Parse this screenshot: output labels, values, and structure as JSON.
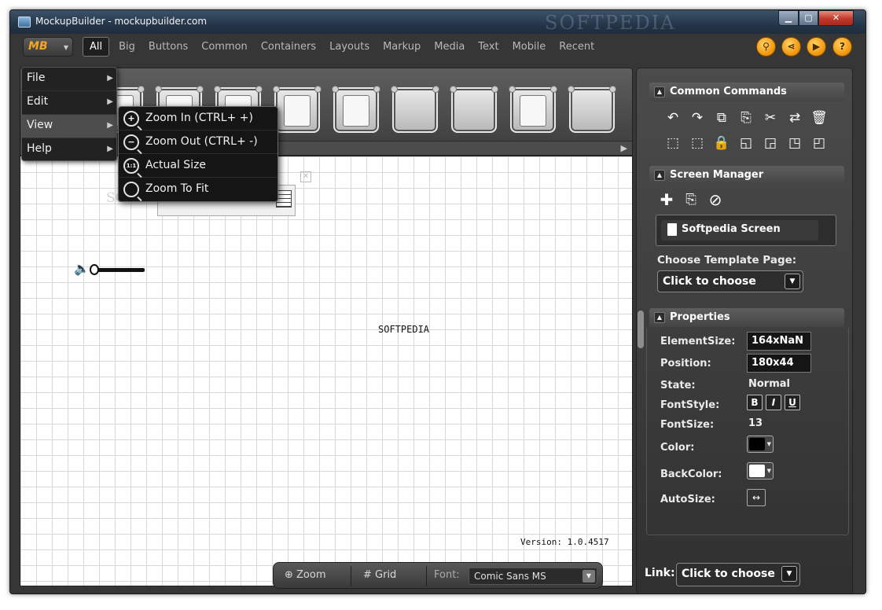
{
  "window": {
    "title": "MockupBuilder - mockupbuilder.com",
    "watermark": "SOFTPEDIA",
    "min": "▁",
    "max": "▢",
    "close": "✕"
  },
  "logo": {
    "text": "MB",
    "caret": "▼"
  },
  "tabs": [
    "All",
    "Big",
    "Buttons",
    "Common",
    "Containers",
    "Layouts",
    "Markup",
    "Media",
    "Text",
    "Mobile",
    "Recent"
  ],
  "top_buttons": [
    {
      "name": "search-icon",
      "glyph": "⚲"
    },
    {
      "name": "share-icon",
      "glyph": "⋖"
    },
    {
      "name": "play-icon",
      "glyph": "▶"
    },
    {
      "name": "help-icon",
      "glyph": "?"
    }
  ],
  "toolbar": {
    "scroll_arrow": "▶"
  },
  "menu": {
    "items": [
      {
        "label": "File",
        "sub": "▶"
      },
      {
        "label": "Edit",
        "sub": "▶"
      },
      {
        "label": "View",
        "sub": "▶"
      },
      {
        "label": "Help",
        "sub": "▶"
      }
    ],
    "highlighted": "View"
  },
  "view_submenu": [
    {
      "label": "Zoom In (CTRL+ +)",
      "icon": "zoom-in-icon",
      "glyph": "+"
    },
    {
      "label": "Zoom Out (CTRL+ -)",
      "icon": "zoom-out-icon",
      "glyph": "−"
    },
    {
      "label": "Actual Size",
      "icon": "actual-size-icon",
      "glyph": "1:1"
    },
    {
      "label": "Zoom To Fit",
      "icon": "zoom-fit-icon",
      "glyph": ""
    }
  ],
  "canvas": {
    "label": "SOFTPEDIA",
    "version": "Version: 1.0.4517",
    "element_shadow_text": "SOFTPEDIA",
    "close_glyph": "✕",
    "speaker_glyph": "🔈"
  },
  "bottombar": {
    "zoom": "Zoom",
    "grid": "Grid",
    "font_label": "Font:",
    "font_value": "Comic Sans MS",
    "dd": "▼"
  },
  "common_commands": {
    "title": "Common Commands",
    "row1": [
      "↶",
      "↷",
      "⧉",
      "⎘",
      "✂",
      "⇄",
      "🗑"
    ],
    "row2": [
      "⬚",
      "⬚",
      "🔒",
      "◱",
      "◲",
      "◳",
      "◰"
    ]
  },
  "screen_manager": {
    "title": "Screen Manager",
    "buttons": [
      "✚",
      "⎘",
      "⊘"
    ],
    "screen": "Softpedia Screen",
    "template_label": "Choose Template Page:",
    "template_value": "Click to choose",
    "dd": "▼"
  },
  "properties": {
    "title": "Properties",
    "element_size_label": "ElementSize:",
    "element_size": "164xNaN",
    "position_label": "Position:",
    "position": "180x44",
    "state_label": "State:",
    "state": "Normal",
    "fontstyle_label": "FontStyle:",
    "bold": "B",
    "italic": "I",
    "underline": "U",
    "fontsize_label": "FontSize:",
    "fontsize": "13",
    "color_label": "Color:",
    "color": "#000000",
    "backcolor_label": "BackColor:",
    "backcolor": "#ffffff",
    "autosize_label": "AutoSize:",
    "autosize_glyph": "↔"
  },
  "link": {
    "label": "Link:",
    "value": "Click to choose",
    "dd": "▼"
  },
  "section_chev": "▲"
}
